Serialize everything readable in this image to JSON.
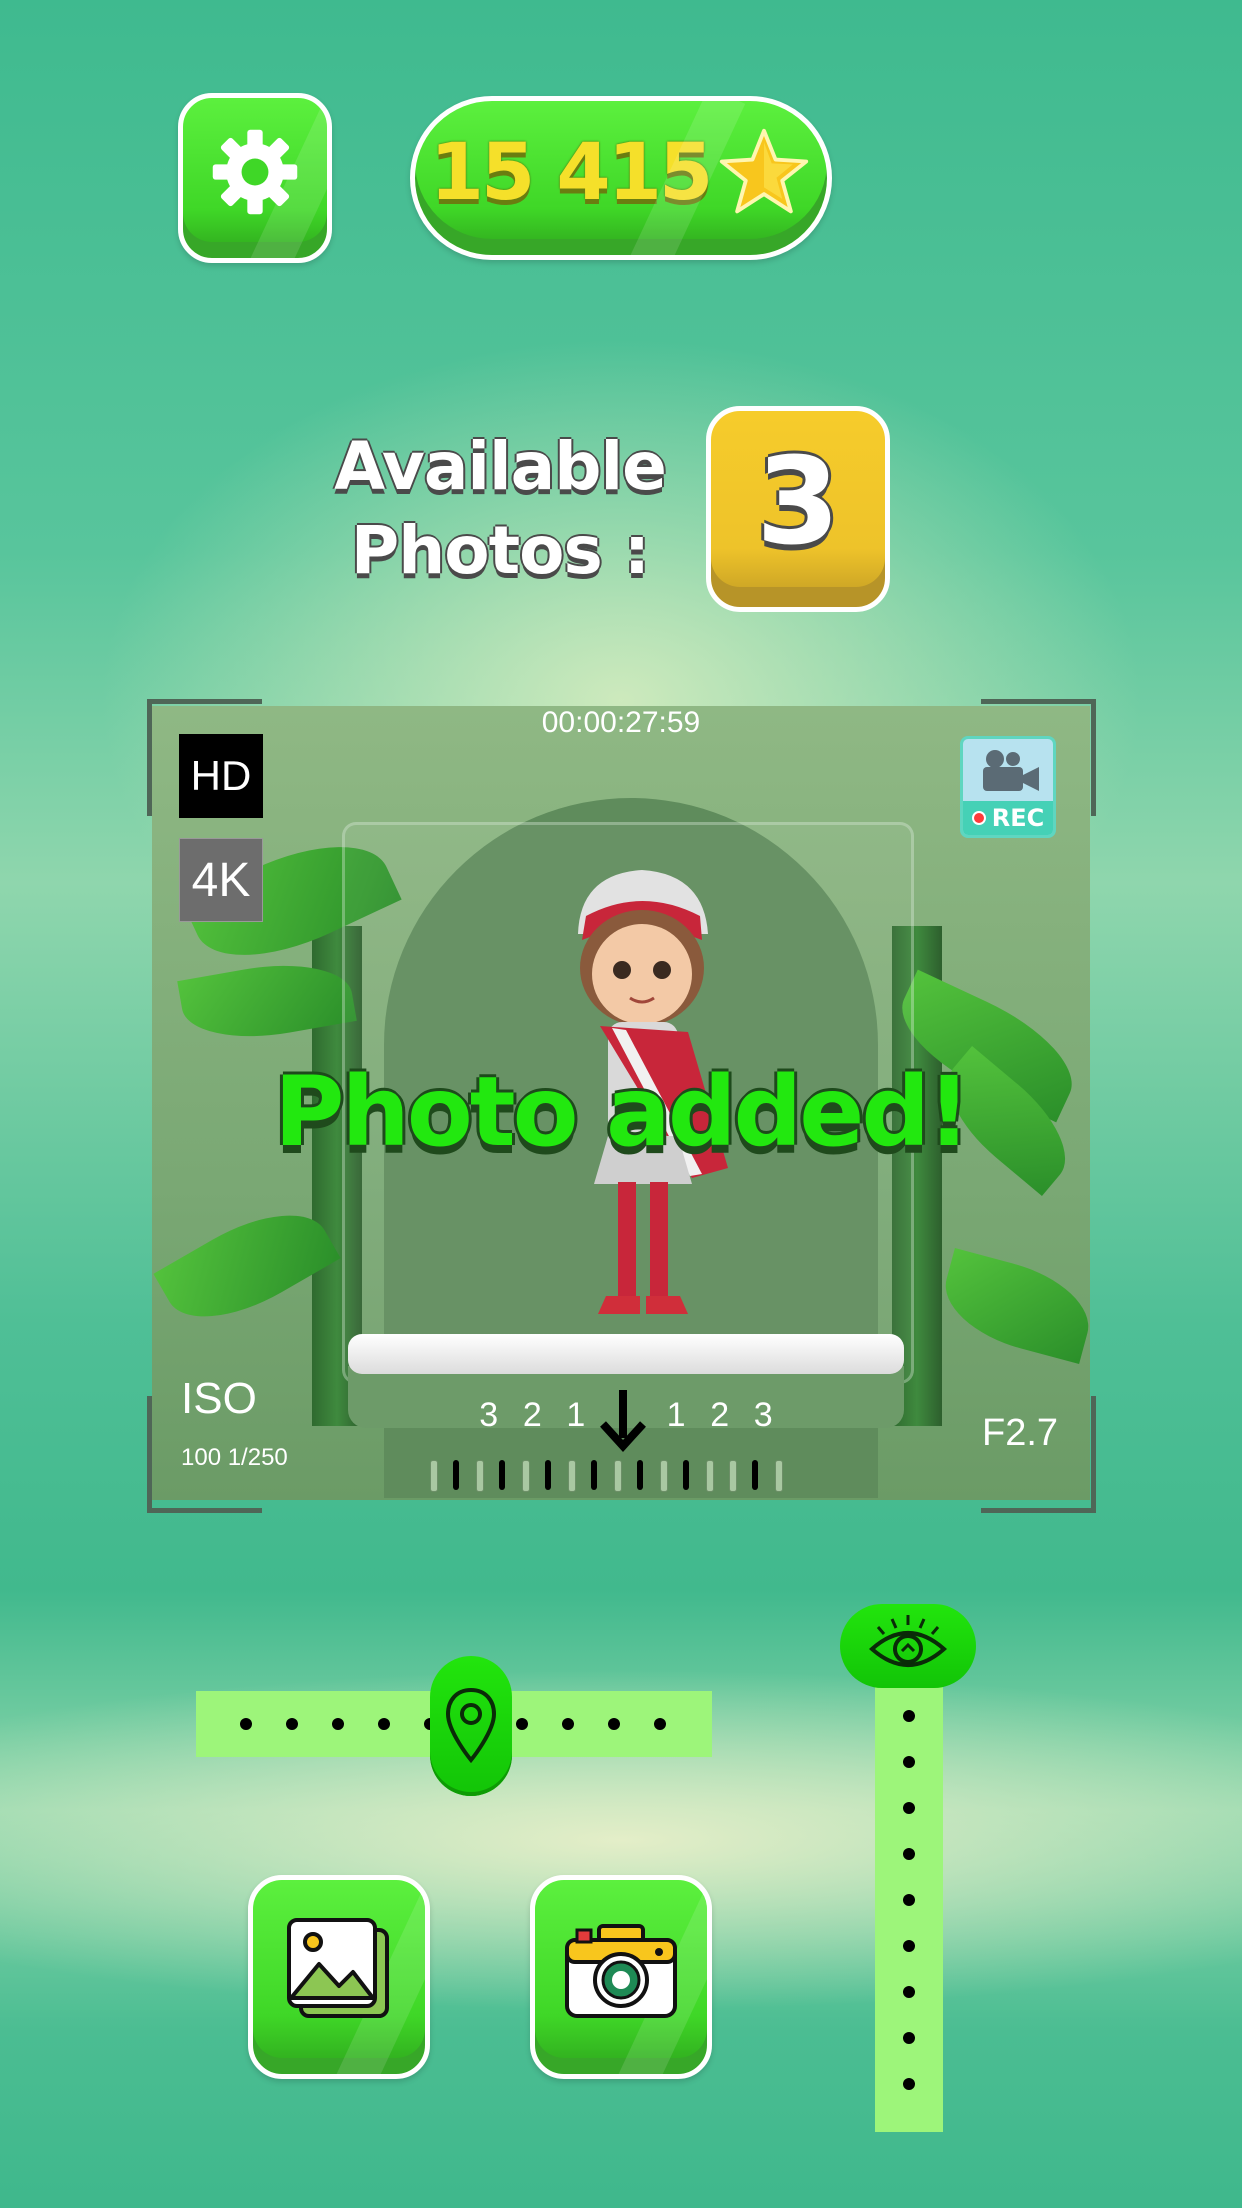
{
  "header": {
    "settings_icon": "gear-icon",
    "score": "15 415",
    "score_icon": "star-icon"
  },
  "photos": {
    "label_line1": "Available",
    "label_line2": "Photos :",
    "count": "3"
  },
  "viewfinder": {
    "timer": "00:00:27:59",
    "hd_label": "HD",
    "k4_label": "4K",
    "rec_icon": "video-camera-icon",
    "rec_label": "REC",
    "iso_label": "ISO",
    "iso_value": "100 1/250",
    "aperture": "F2.7",
    "scale": [
      "3",
      "2",
      "1",
      "1",
      "2",
      "3"
    ],
    "message": "Photo added!"
  },
  "controls": {
    "horizontal_slider_icon": "location-pin-icon",
    "vertical_slider_icon": "eye-icon",
    "gallery_icon": "image-gallery-icon",
    "camera_icon": "camera-icon"
  },
  "colors": {
    "button_green": "#3fd727",
    "score_text": "#f5e02a",
    "count_box": "#eec32a",
    "message_green": "#22e80f",
    "slider_track": "#9df57a"
  }
}
